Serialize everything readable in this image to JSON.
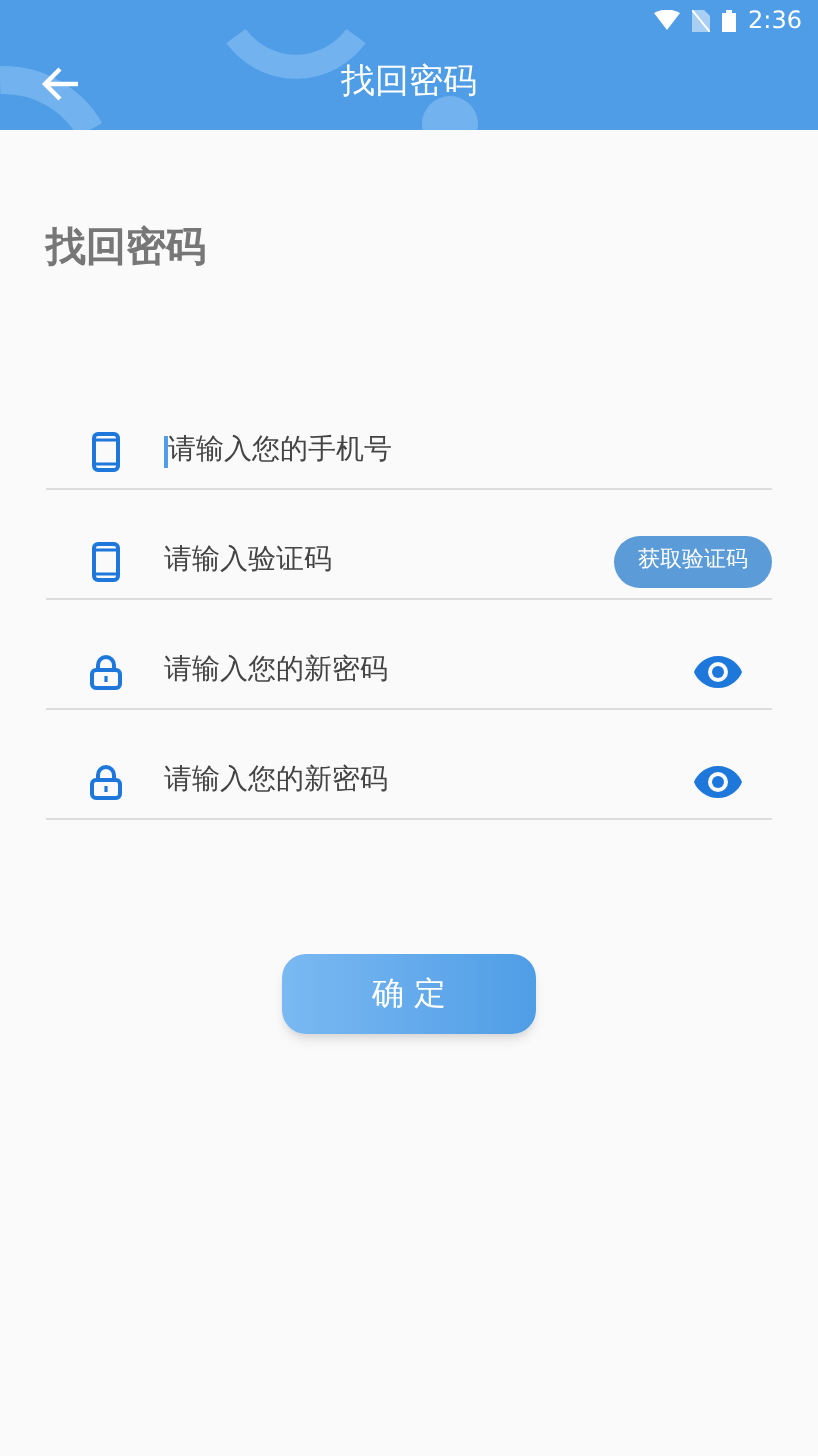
{
  "status_bar": {
    "time": "2:36"
  },
  "header": {
    "title": "找回密码"
  },
  "page_title": "找回密码",
  "fields": [
    {
      "kind": "phone",
      "placeholder": "请输入您的手机号",
      "focused": true
    },
    {
      "kind": "phone",
      "placeholder": "请输入验证码",
      "focused": false,
      "action": {
        "kind": "button",
        "label": "获取验证码"
      }
    },
    {
      "kind": "lock",
      "placeholder": "请输入您的新密码",
      "focused": false,
      "action": {
        "kind": "eye"
      }
    },
    {
      "kind": "lock",
      "placeholder": "请输入您的新密码",
      "focused": false,
      "action": {
        "kind": "eye"
      }
    }
  ],
  "submit_button": "确 定"
}
